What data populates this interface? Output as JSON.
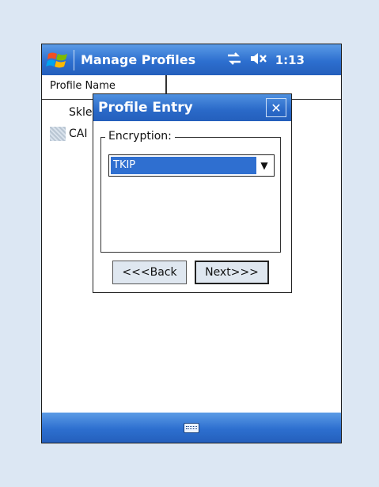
{
  "titlebar": {
    "app_title": "Manage Profiles",
    "time": "1:13",
    "icons": [
      "windows-start-icon",
      "connectivity-icon",
      "volume-muted-icon"
    ]
  },
  "list": {
    "column_header": "Profile Name",
    "rows": [
      {
        "label": "Skle"
      },
      {
        "label": "CAI"
      }
    ]
  },
  "dialog": {
    "title": "Profile Entry",
    "close_label": "✕",
    "group_label": "Encryption:",
    "combo_value": "TKIP",
    "back_label": "<<<Back",
    "next_label": "Next>>>"
  },
  "bottombar": {
    "icon": "keyboard-icon"
  },
  "colors": {
    "titlebar_blue": "#2d6fcf",
    "selection_blue": "#2f6fd0",
    "background": "#dce7f3"
  }
}
